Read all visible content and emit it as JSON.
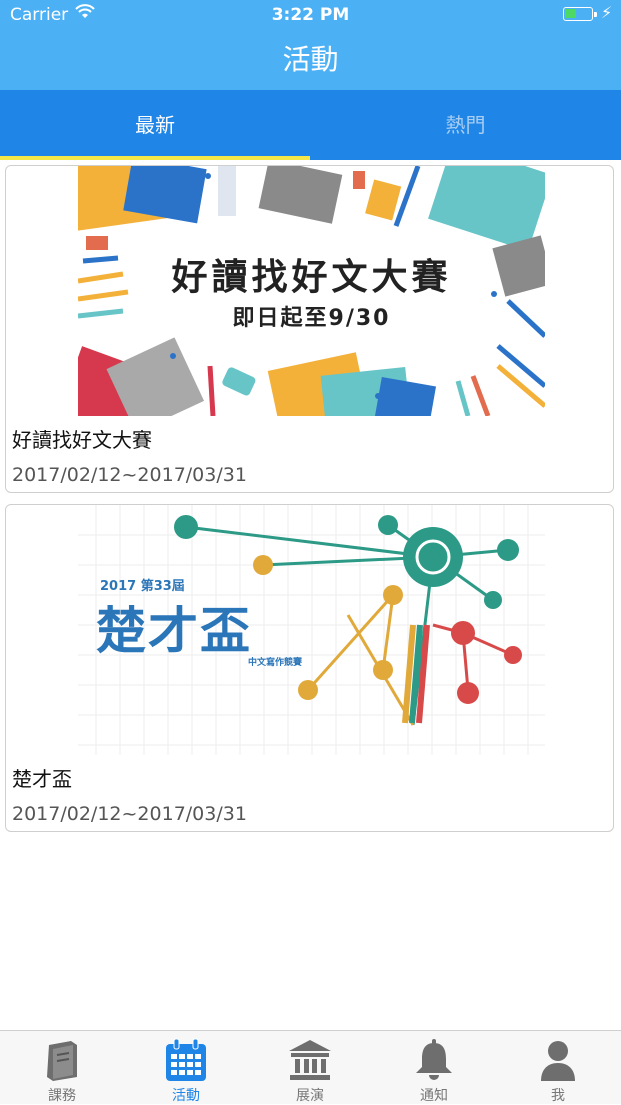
{
  "status_bar": {
    "carrier": "Carrier",
    "time": "3:22 PM",
    "battery_level": 0.45
  },
  "header": {
    "title": "活動"
  },
  "tabs": [
    {
      "label": "最新",
      "selected": true
    },
    {
      "label": "熱門",
      "selected": false
    }
  ],
  "activities": [
    {
      "title": "好讀找好文大賽",
      "date": "2017/02/12~2017/03/31",
      "banner": {
        "headline": "好讀找好文大賽",
        "subline": "即日起至9/30"
      }
    },
    {
      "title": "楚才盃",
      "date": "2017/02/12~2017/03/31",
      "banner": {
        "edition": "2017 第33屆",
        "headline": "楚才盃",
        "subline": "中文寫作競賽"
      }
    }
  ],
  "tab_bar": [
    {
      "label": "課務",
      "icon": "book-icon",
      "active": false
    },
    {
      "label": "活動",
      "icon": "calendar-icon",
      "active": true
    },
    {
      "label": "展演",
      "icon": "museum-icon",
      "active": false
    },
    {
      "label": "通知",
      "icon": "bell-icon",
      "active": false
    },
    {
      "label": "我",
      "icon": "person-icon",
      "active": false
    }
  ],
  "colors": {
    "header": "#4cb0f5",
    "tabs": "#1f86e8",
    "indicator": "#f5e64a",
    "active_tab_icon": "#1f86e8",
    "inactive_tab_icon": "#6e6e6e"
  }
}
